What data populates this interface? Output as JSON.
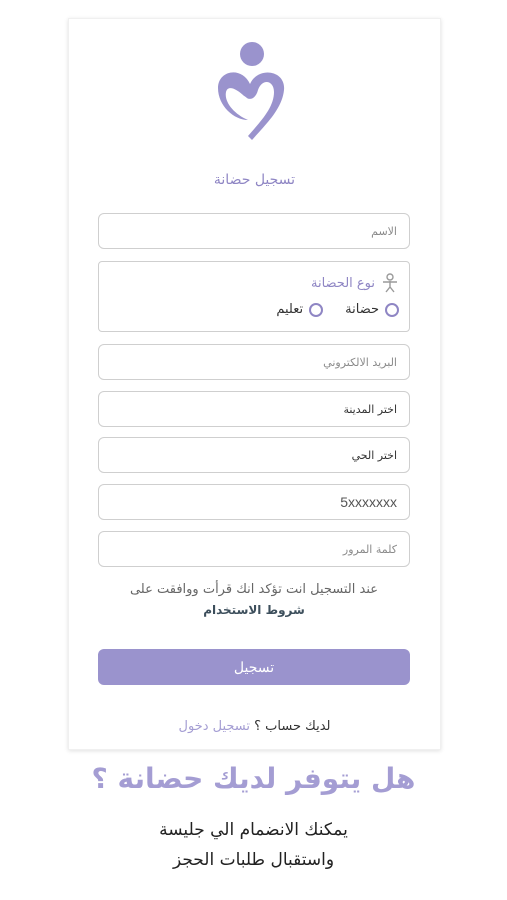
{
  "brand": {
    "accent": "#9a93cd",
    "accent_light": "#a49dd3",
    "logo_icon": "mother-heart-logo"
  },
  "form": {
    "title": "تسجيل حضانة",
    "name_placeholder": "الاسم",
    "type": {
      "label": "نوع الحضانة",
      "icon": "child-icon",
      "options": [
        "حضانة",
        "تعليم"
      ]
    },
    "email_placeholder": "البريد الالكتروني",
    "city_label": "اختر المدينة",
    "district_label": "اختر الحي",
    "phone_value": "5xxxxxxx",
    "password_placeholder": "كلمة المرور",
    "terms_text": "عند التسجيل انت تؤكد انك قرأت ووافقت على",
    "terms_link": "شروط الاستخدام",
    "submit_label": "تسجيل",
    "have_account": "لديك حساب ؟",
    "login_link": "تسجيل دخول"
  },
  "promo": {
    "headline": "هل يتوفر لديك حضانة ؟",
    "line1": "يمكنك الانضمام الي جليسة",
    "line2": "واستقبال طلبات الحجز"
  }
}
